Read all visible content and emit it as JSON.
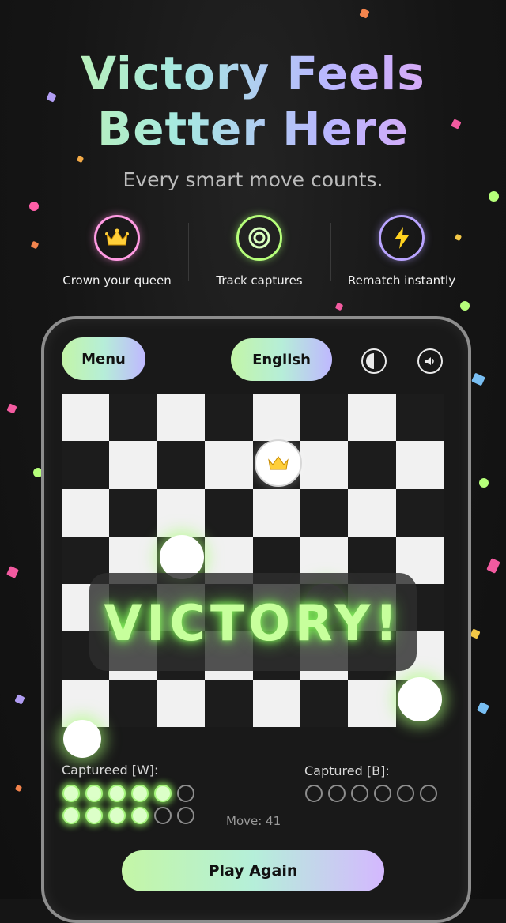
{
  "headline": {
    "line1": "Victory Feels",
    "line2": "Better Here"
  },
  "subtitle": "Every smart move counts.",
  "features": [
    {
      "label": "Crown your queen",
      "icon": "crown-icon"
    },
    {
      "label": "Track captures",
      "icon": "target-icon"
    },
    {
      "label": "Rematch instantly",
      "icon": "lightning-icon"
    }
  ],
  "toolbar": {
    "menu_label": "Menu",
    "language_label": "English",
    "theme_icon": "contrast-icon",
    "sound_icon": "speaker-icon"
  },
  "game": {
    "victory_text": "VICTORY!",
    "captured_white_label": "Captureed [W]:",
    "captured_black_label": "Captured [B]:",
    "captured_white_count": 9,
    "captured_black_count": 0,
    "slots_per_side": 12,
    "move_text": "Move: 41"
  },
  "cta": {
    "play_again_label": "Play Again"
  },
  "colors": {
    "accent_green": "#c7ff9c",
    "gradient_start": "#c3f5a7",
    "gradient_end": "#bfb8ff"
  }
}
